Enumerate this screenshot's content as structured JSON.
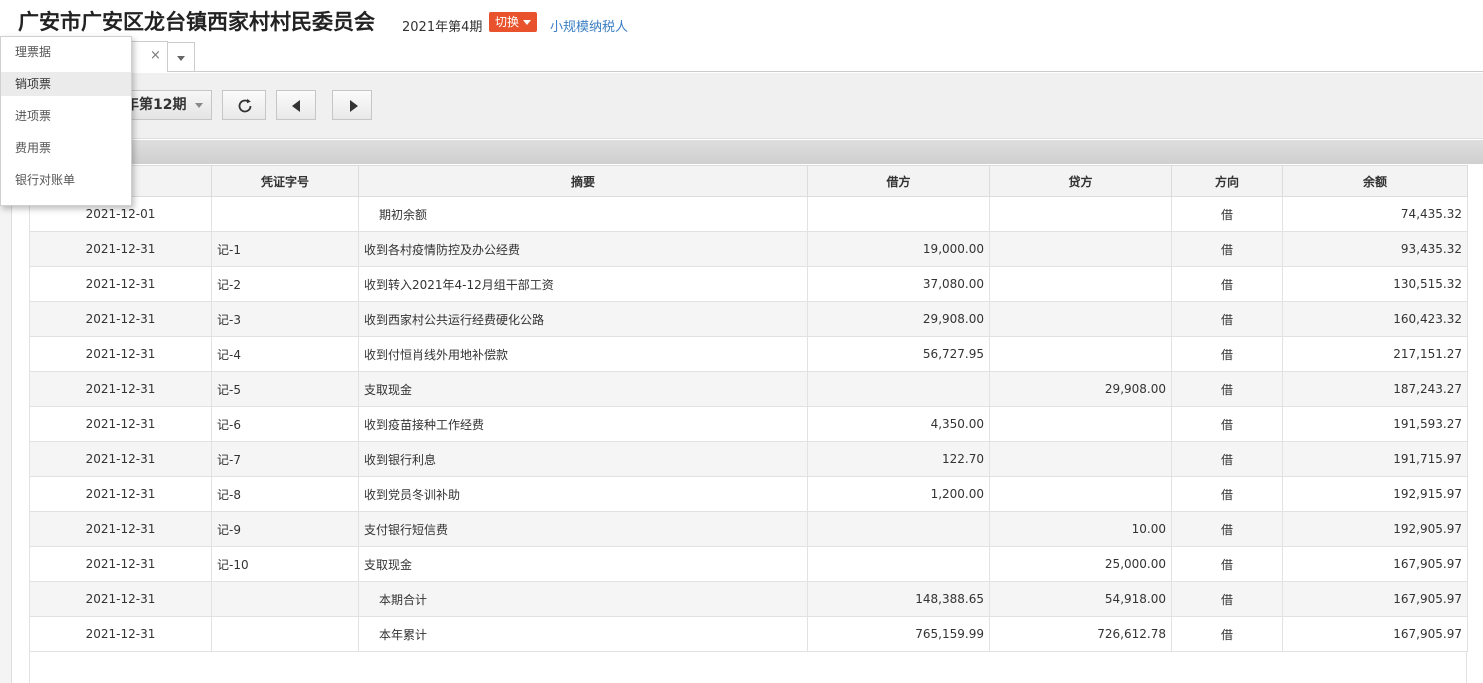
{
  "header": {
    "company": "广安市广安区龙台镇西家村村民委员会",
    "period": "2021年第4期",
    "switch_label": "切换",
    "taxpayer_type": "小规模纳税人"
  },
  "tab": {
    "close": "×"
  },
  "toolbar": {
    "period_select": "年第12期"
  },
  "menu": {
    "items": [
      "理票据",
      "销项票",
      "进项票",
      "费用票",
      "银行对账单"
    ],
    "hover_index": 1
  },
  "table": {
    "columns": [
      "",
      "凭证字号",
      "摘要",
      "借方",
      "贷方",
      "方向",
      "余额"
    ],
    "rows": [
      {
        "date": "2021-12-01",
        "voucher": "",
        "summary": "期初余额",
        "debit": "",
        "credit": "",
        "dir": "借",
        "balance": "74,435.32"
      },
      {
        "date": "2021-12-31",
        "voucher": "记-1",
        "summary": "收到各村疫情防控及办公经费",
        "debit": "19,000.00",
        "credit": "",
        "dir": "借",
        "balance": "93,435.32"
      },
      {
        "date": "2021-12-31",
        "voucher": "记-2",
        "summary": "收到转入2021年4-12月组干部工资",
        "debit": "37,080.00",
        "credit": "",
        "dir": "借",
        "balance": "130,515.32"
      },
      {
        "date": "2021-12-31",
        "voucher": "记-3",
        "summary": "收到西家村公共运行经费硬化公路",
        "debit": "29,908.00",
        "credit": "",
        "dir": "借",
        "balance": "160,423.32"
      },
      {
        "date": "2021-12-31",
        "voucher": "记-4",
        "summary": "收到付恒肖线外用地补偿款",
        "debit": "56,727.95",
        "credit": "",
        "dir": "借",
        "balance": "217,151.27"
      },
      {
        "date": "2021-12-31",
        "voucher": "记-5",
        "summary": "支取现金",
        "debit": "",
        "credit": "29,908.00",
        "dir": "借",
        "balance": "187,243.27"
      },
      {
        "date": "2021-12-31",
        "voucher": "记-6",
        "summary": "收到疫苗接种工作经费",
        "debit": "4,350.00",
        "credit": "",
        "dir": "借",
        "balance": "191,593.27"
      },
      {
        "date": "2021-12-31",
        "voucher": "记-7",
        "summary": "收到银行利息",
        "debit": "122.70",
        "credit": "",
        "dir": "借",
        "balance": "191,715.97"
      },
      {
        "date": "2021-12-31",
        "voucher": "记-8",
        "summary": "收到党员冬训补助",
        "debit": "1,200.00",
        "credit": "",
        "dir": "借",
        "balance": "192,915.97"
      },
      {
        "date": "2021-12-31",
        "voucher": "记-9",
        "summary": "支付银行短信费",
        "debit": "",
        "credit": "10.00",
        "dir": "借",
        "balance": "192,905.97"
      },
      {
        "date": "2021-12-31",
        "voucher": "记-10",
        "summary": "支取现金",
        "debit": "",
        "credit": "25,000.00",
        "dir": "借",
        "balance": "167,905.97"
      },
      {
        "date": "2021-12-31",
        "voucher": "",
        "summary": "本期合计",
        "debit": "148,388.65",
        "credit": "54,918.00",
        "dir": "借",
        "balance": "167,905.97"
      },
      {
        "date": "2021-12-31",
        "voucher": "",
        "summary": "本年累计",
        "debit": "765,159.99",
        "credit": "726,612.78",
        "dir": "借",
        "balance": "167,905.97"
      }
    ],
    "indented_summaries": [
      0,
      11,
      12
    ]
  },
  "icons": {
    "refresh": "refresh-icon",
    "prev": "triangle-left-icon",
    "next": "triangle-right-icon"
  },
  "colors": {
    "switch_bg": "#e8522c",
    "link": "#3b7fc4"
  }
}
